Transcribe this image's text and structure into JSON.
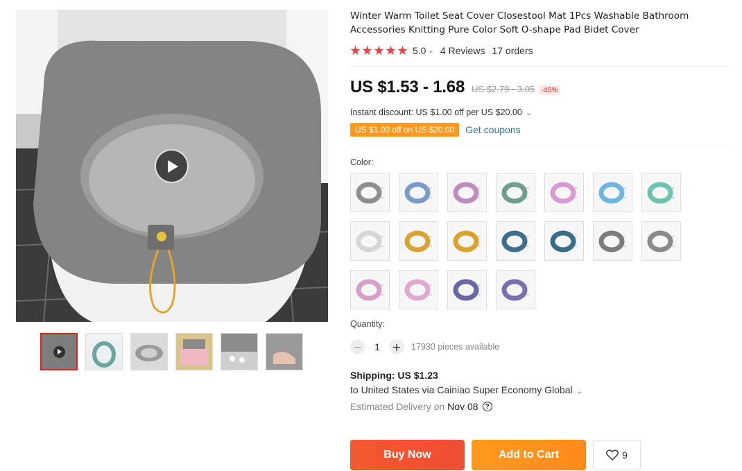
{
  "product": {
    "title": "Winter Warm Toilet Seat Cover Closestool Mat 1Pcs Washable Bathroom Accessories Knitting Pure Color Soft O-shape Pad Bidet Cover",
    "rating": "5.0",
    "reviews": "4 Reviews",
    "orders": "17 orders",
    "stars": 5
  },
  "price": {
    "current": "US $1.53 - 1.68",
    "original": "US $2.79 - 3.05",
    "discount": "-45%",
    "instant_discount": "Instant discount: US $1.00 off per US $20.00",
    "coupon_badge": "US $1.00 off on US $20.00",
    "coupon_link": "Get coupons"
  },
  "options": {
    "color_label": "Color:",
    "swatch_colors": [
      "#8e8e8e",
      "#7a9cc8",
      "#c08cbf",
      "#6f9f8c",
      "#d89ad0",
      "#6db6e0",
      "#6cc3b0",
      "#d6d6d6",
      "#d9a233",
      "#dba32a",
      "#3d6f8c",
      "#356e86",
      "#7c7c7c",
      "#8a8a8a",
      "#d7a0c8",
      "#e0a9d2",
      "#6a64a8",
      "#7a6fb0"
    ]
  },
  "quantity": {
    "label": "Quantity:",
    "minus": "−",
    "plus": "+",
    "value": "1",
    "available": "17930 pieces available"
  },
  "shipping": {
    "title": "Shipping: US $1.23",
    "route": "to United States via Cainiao Super Economy Global",
    "delivery_label": "Estimated Delivery on",
    "delivery_date": "Nov 08",
    "help_icon": "?"
  },
  "actions": {
    "buy_now": "Buy Now",
    "add_to_cart": "Add to Cart",
    "wishlist_count": "9"
  },
  "icons": {
    "play": "play-icon",
    "heart": "heart-icon",
    "chevron": "chevron-down-icon",
    "help": "question-circle-icon"
  }
}
